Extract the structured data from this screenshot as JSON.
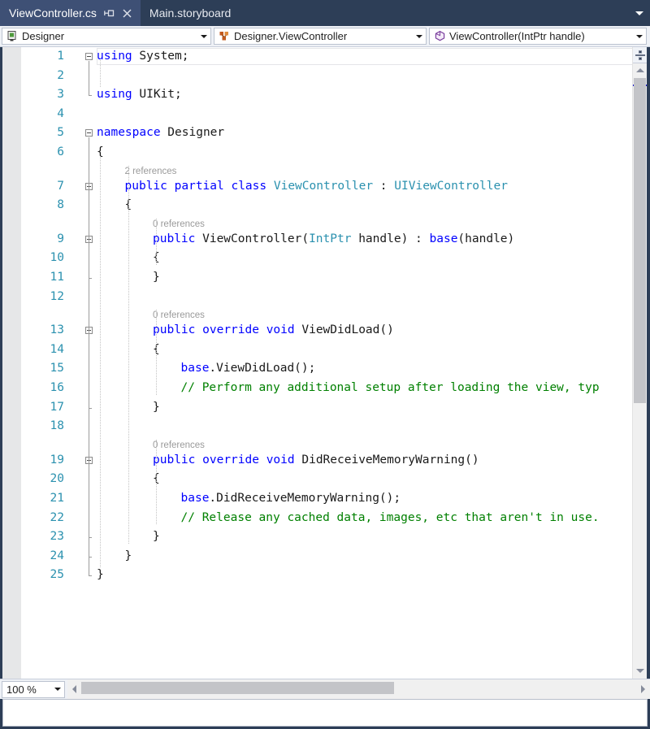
{
  "window": {
    "tabs": [
      {
        "label": "ViewController.cs",
        "active": true,
        "pin_icon": "pin-icon",
        "close_icon": "close-icon"
      },
      {
        "label": "Main.storyboard",
        "active": false
      }
    ],
    "tab_overflow_icon": "chevron-down-icon"
  },
  "navbar": {
    "project_dropdown": {
      "value": "Designer",
      "icon": "project-icon"
    },
    "type_dropdown": {
      "value": "Designer.ViewController",
      "icon": "class-icon"
    },
    "member_dropdown": {
      "value": "ViewController(IntPtr handle)",
      "icon": "method-icon"
    }
  },
  "editor": {
    "lines": [
      {
        "n": "1",
        "codelens": null,
        "tokens": [
          {
            "t": "using",
            "c": "kw"
          },
          {
            "t": " System;",
            "c": "pl"
          }
        ],
        "indent": 0,
        "current": true
      },
      {
        "n": "2",
        "codelens": null,
        "tokens": [],
        "indent": 0
      },
      {
        "n": "3",
        "codelens": null,
        "tokens": [
          {
            "t": "using",
            "c": "kw"
          },
          {
            "t": " UIKit;",
            "c": "pl"
          }
        ],
        "indent": 0
      },
      {
        "n": "4",
        "codelens": null,
        "tokens": [],
        "indent": 0
      },
      {
        "n": "5",
        "codelens": null,
        "tokens": [
          {
            "t": "namespace",
            "c": "kw"
          },
          {
            "t": " Designer",
            "c": "pl"
          }
        ],
        "indent": 0
      },
      {
        "n": "6",
        "codelens": null,
        "tokens": [
          {
            "t": "{",
            "c": "pl"
          }
        ],
        "indent": 0
      },
      {
        "n": "7",
        "codelens": "2 references",
        "tokens": [
          {
            "t": "public",
            "c": "kw"
          },
          {
            "t": " ",
            "c": "pl"
          },
          {
            "t": "partial",
            "c": "kw"
          },
          {
            "t": " ",
            "c": "pl"
          },
          {
            "t": "class",
            "c": "kw"
          },
          {
            "t": " ",
            "c": "pl"
          },
          {
            "t": "ViewController",
            "c": "typ"
          },
          {
            "t": " : ",
            "c": "pl"
          },
          {
            "t": "UIViewController",
            "c": "typ"
          }
        ],
        "indent": 1
      },
      {
        "n": "8",
        "codelens": null,
        "tokens": [
          {
            "t": "{",
            "c": "pl"
          }
        ],
        "indent": 1
      },
      {
        "n": "9",
        "codelens": "0 references",
        "tokens": [
          {
            "t": "public",
            "c": "kw"
          },
          {
            "t": " ViewController(",
            "c": "pl"
          },
          {
            "t": "IntPtr",
            "c": "typ"
          },
          {
            "t": " handle) : ",
            "c": "pl"
          },
          {
            "t": "base",
            "c": "kw"
          },
          {
            "t": "(handle)",
            "c": "pl"
          }
        ],
        "indent": 2
      },
      {
        "n": "10",
        "codelens": null,
        "tokens": [
          {
            "t": "{",
            "c": "pl"
          }
        ],
        "indent": 2
      },
      {
        "n": "11",
        "codelens": null,
        "tokens": [
          {
            "t": "}",
            "c": "pl"
          }
        ],
        "indent": 2
      },
      {
        "n": "12",
        "codelens": null,
        "tokens": [],
        "indent": 0
      },
      {
        "n": "13",
        "codelens": "0 references",
        "tokens": [
          {
            "t": "public",
            "c": "kw"
          },
          {
            "t": " ",
            "c": "pl"
          },
          {
            "t": "override",
            "c": "kw"
          },
          {
            "t": " ",
            "c": "pl"
          },
          {
            "t": "void",
            "c": "kw"
          },
          {
            "t": " ViewDidLoad()",
            "c": "pl"
          }
        ],
        "indent": 2
      },
      {
        "n": "14",
        "codelens": null,
        "tokens": [
          {
            "t": "{",
            "c": "pl"
          }
        ],
        "indent": 2
      },
      {
        "n": "15",
        "codelens": null,
        "tokens": [
          {
            "t": "base",
            "c": "kw"
          },
          {
            "t": ".ViewDidLoad();",
            "c": "pl"
          }
        ],
        "indent": 3
      },
      {
        "n": "16",
        "codelens": null,
        "tokens": [
          {
            "t": "// Perform any additional setup after loading the view, typ",
            "c": "cm"
          }
        ],
        "indent": 3
      },
      {
        "n": "17",
        "codelens": null,
        "tokens": [
          {
            "t": "}",
            "c": "pl"
          }
        ],
        "indent": 2
      },
      {
        "n": "18",
        "codelens": null,
        "tokens": [],
        "indent": 0
      },
      {
        "n": "19",
        "codelens": "0 references",
        "tokens": [
          {
            "t": "public",
            "c": "kw"
          },
          {
            "t": " ",
            "c": "pl"
          },
          {
            "t": "override",
            "c": "kw"
          },
          {
            "t": " ",
            "c": "pl"
          },
          {
            "t": "void",
            "c": "kw"
          },
          {
            "t": " DidReceiveMemoryWarning()",
            "c": "pl"
          }
        ],
        "indent": 2
      },
      {
        "n": "20",
        "codelens": null,
        "tokens": [
          {
            "t": "{",
            "c": "pl"
          }
        ],
        "indent": 2
      },
      {
        "n": "21",
        "codelens": null,
        "tokens": [
          {
            "t": "base",
            "c": "kw"
          },
          {
            "t": ".DidReceiveMemoryWarning();",
            "c": "pl"
          }
        ],
        "indent": 3
      },
      {
        "n": "22",
        "codelens": null,
        "tokens": [
          {
            "t": "// Release any cached data, images, etc that aren't in use.",
            "c": "cm"
          }
        ],
        "indent": 3
      },
      {
        "n": "23",
        "codelens": null,
        "tokens": [
          {
            "t": "}",
            "c": "pl"
          }
        ],
        "indent": 2
      },
      {
        "n": "24",
        "codelens": null,
        "tokens": [
          {
            "t": "}",
            "c": "pl"
          }
        ],
        "indent": 1
      },
      {
        "n": "25",
        "codelens": null,
        "tokens": [
          {
            "t": "}",
            "c": "pl"
          }
        ],
        "indent": 0
      }
    ],
    "outline_boxes": [
      {
        "line": 1,
        "state": "expanded"
      },
      {
        "line": 5,
        "state": "expanded"
      },
      {
        "line": 7,
        "state": "expanded"
      },
      {
        "line": 9,
        "state": "expanded"
      },
      {
        "line": 13,
        "state": "expanded"
      },
      {
        "line": 19,
        "state": "expanded"
      }
    ]
  },
  "scrollbars": {
    "split_view_icon": "split-view-icon",
    "vertical_up_icon": "triangle-up-icon",
    "vertical_down_icon": "triangle-down-icon",
    "horizontal_left_icon": "triangle-left-icon",
    "horizontal_right_icon": "triangle-right-icon"
  },
  "bottom": {
    "zoom": {
      "value": "100 %",
      "arrow_icon": "chevron-down-icon"
    }
  },
  "colors": {
    "chrome": "#2d3e57",
    "tab_active": "#3e5075",
    "keyword": "#0000ff",
    "type": "#2b91af",
    "comment": "#008000",
    "linenumber": "#2b91af",
    "codelens": "#9a9a9a",
    "caret_marker": "#2222cc"
  }
}
